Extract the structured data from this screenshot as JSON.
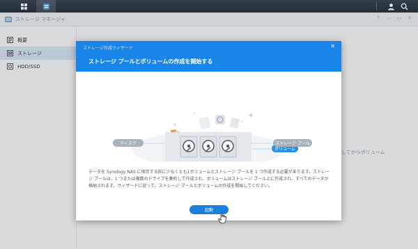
{
  "app": {
    "title": "ストレージ マネージャ",
    "window_controls": [
      "?",
      "—",
      "▭",
      "✕"
    ]
  },
  "sidebar": {
    "items": [
      {
        "label": "概要",
        "icon": "overview-icon",
        "active": false
      },
      {
        "label": "ストレージ",
        "icon": "storage-icon",
        "active": true
      },
      {
        "label": "HDD/SSD",
        "icon": "hdd-icon",
        "active": false
      }
    ]
  },
  "background": {
    "partial_text": "してからボリューム"
  },
  "wizard": {
    "window_title": "ストレージ作成ウィザード",
    "heading": "ストレージ プールとボリュームの作成を開始する",
    "labels": {
      "volume": "ボリューム",
      "disk": "ディスク",
      "storage_pool": "ストレージ プール"
    },
    "description": "データを Synology NAS に保存する前に少なくとも1ボリュームとストレージ プールを 1 つ作成する必要があります。ストレージ プールは、1 つまたは複数のドライブを集約して作成され、ボリュームはストレージ プール上に作成され、すべてのデータが格納されます。ウィザードに従って、ストレージ プールとボリュームの作成を開始してください。",
    "start_button": "起動"
  },
  "colors": {
    "accent": "#1a85e8",
    "topbar": "#2b3540"
  }
}
